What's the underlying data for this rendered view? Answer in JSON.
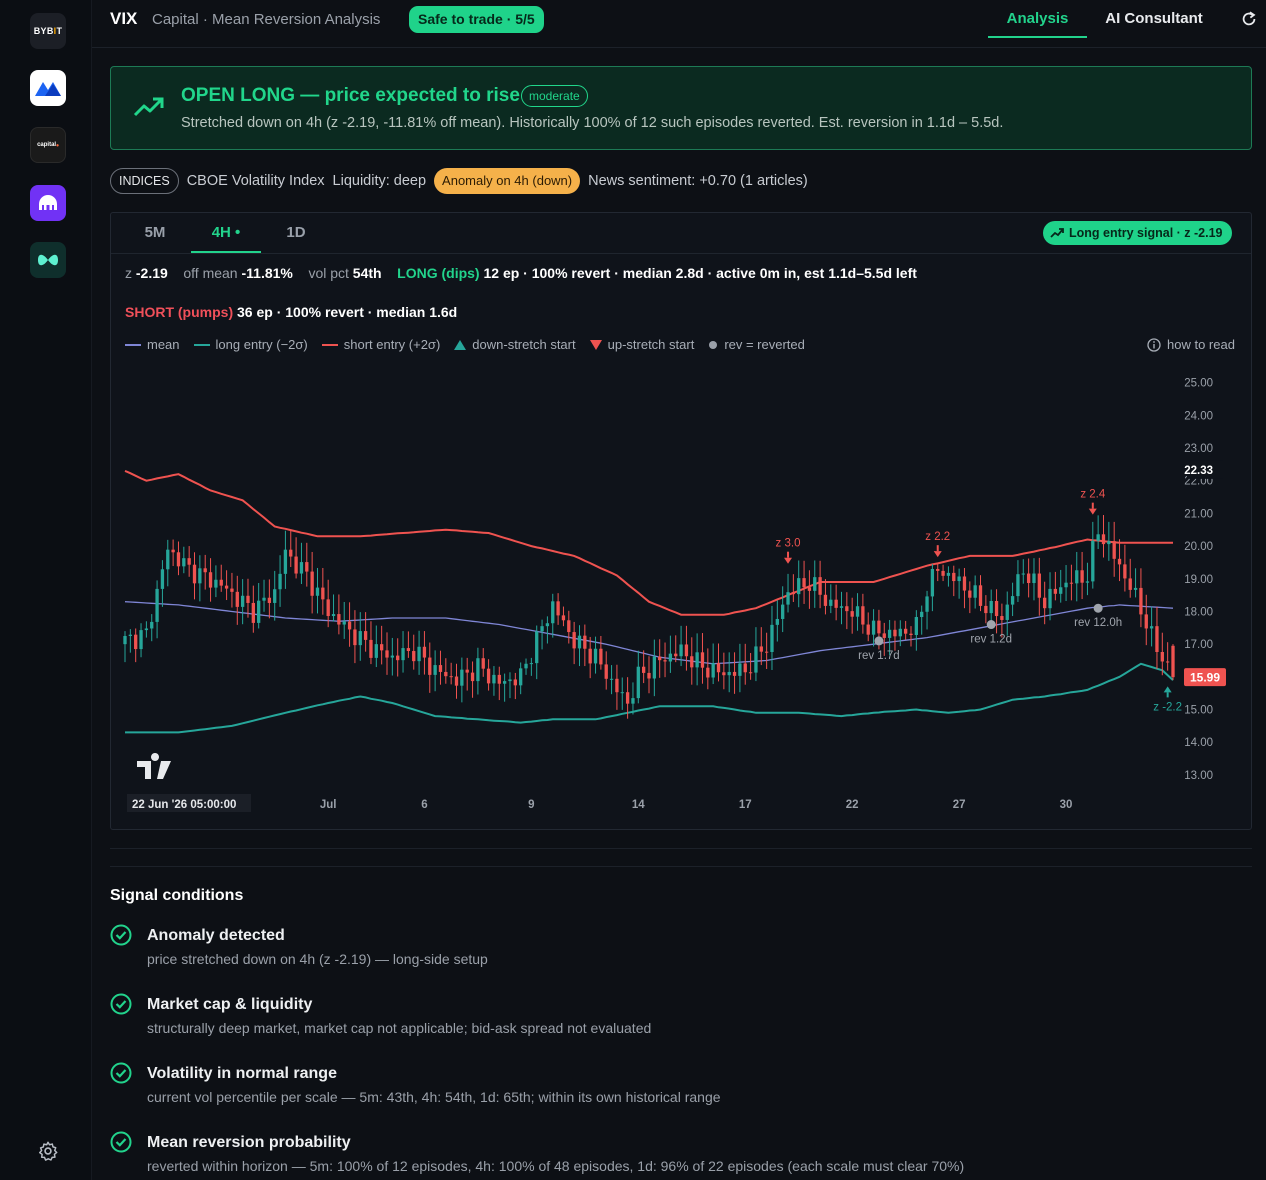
{
  "rail": {
    "bybit_label": "BYB",
    "bybit_bar": "I",
    "bybit_end": "T",
    "capital_label": "capital",
    "items": [
      "bybit",
      "mexc",
      "capital",
      "kraken",
      "other"
    ]
  },
  "header": {
    "ticker": "VIX",
    "subtitle": "Capital · Mean Reversion Analysis",
    "safe_badge": "Safe to trade · 5/5",
    "tab_analysis": "Analysis",
    "tab_ai": "AI Consultant"
  },
  "banner": {
    "title": "OPEN LONG — price expected to rise",
    "badge": "moderate",
    "text": "Stretched down on 4h (z -2.19, -11.81% off mean). Historically 100% of 12 such episodes reverted. Est. reversion in 1.1d – 5.5d."
  },
  "info": {
    "indices": "INDICES",
    "name": "CBOE Volatility Index",
    "liquidity": "Liquidity: deep",
    "anomaly": "Anomaly on 4h (down)",
    "news": "News sentiment: +0.70 (1 articles)"
  },
  "panel": {
    "tabs": [
      "5M",
      "4H",
      "1D"
    ],
    "active_dot": "•",
    "long_signal": "Long entry signal · z -2.19",
    "stats": {
      "z_label": "z",
      "z_val": "-2.19",
      "off_label": "off mean",
      "off_val": "-11.81%",
      "vol_label": "vol pct",
      "vol_val": "54th",
      "long_label": "LONG (dips)",
      "long_text": "12 ep · 100% revert · median 2.8d · active 0m in, est 1.1d–5.5d left",
      "short_label": "SHORT (pumps)",
      "short_text": "36 ep · 100% revert · median 1.6d"
    },
    "legend": {
      "mean": "mean",
      "long": "long entry (−2σ)",
      "short": "short entry (+2σ)",
      "down": "down-stretch start",
      "up": "up-stretch start",
      "rev": "rev = reverted",
      "howto": "how to read"
    },
    "colors": {
      "mean": "#7f86d6",
      "long": "#26a69a",
      "short": "#ef5350",
      "up_candle": "#26a69a",
      "down_candle": "#ef5350"
    }
  },
  "chart_data": {
    "type": "candlestick",
    "y_ticks": [
      "25.00",
      "24.00",
      "23.00",
      "22.00",
      "21.00",
      "20.00",
      "19.00",
      "18.00",
      "17.00",
      "16.00",
      "15.00",
      "14.00",
      "13.00"
    ],
    "ylim": [
      12.6,
      25.6
    ],
    "x_ticks": [
      {
        "label": "22 Jun '26  05:00:00",
        "i": 0
      },
      {
        "label": "Jul",
        "i": 38
      },
      {
        "label": "6",
        "i": 56
      },
      {
        "label": "9",
        "i": 76
      },
      {
        "label": "14",
        "i": 96
      },
      {
        "label": "17",
        "i": 116
      },
      {
        "label": "22",
        "i": 136
      },
      {
        "label": "27",
        "i": 156
      },
      {
        "label": "30",
        "i": 176
      }
    ],
    "last_price": "15.99",
    "crosshair_price": "22.33",
    "annotations": {
      "up_markers": [
        {
          "i": 124,
          "label": "z 3.0",
          "price": 19.4
        },
        {
          "i": 152,
          "label": "z 2.2",
          "price": 19.6
        },
        {
          "i": 181,
          "label": "z 2.4",
          "price": 20.9
        }
      ],
      "down_markers": [
        {
          "i": 195,
          "label": "z -2.2",
          "price": 15.8
        }
      ],
      "reverted": [
        {
          "i": 141,
          "label": "rev 1.7d",
          "price": 17.1
        },
        {
          "i": 162,
          "label": "rev 1.2d",
          "price": 17.6
        },
        {
          "i": 182,
          "label": "rev 12.0h",
          "price": 18.1
        }
      ]
    },
    "candles": [],
    "mean": [],
    "upper": [],
    "lower": []
  },
  "conditions": {
    "title": "Signal conditions",
    "items": [
      {
        "title": "Anomaly detected",
        "desc": "price stretched down on 4h (z -2.19) — long-side setup"
      },
      {
        "title": "Market cap & liquidity",
        "desc": "structurally deep market, market cap not applicable; bid-ask spread not evaluated"
      },
      {
        "title": "Volatility in normal range",
        "desc": "current vol percentile per scale — 5m: 43th, 4h: 54th, 1d: 65th; within its own historical range"
      },
      {
        "title": "Mean reversion probability",
        "desc": "reverted within horizon — 5m: 100% of 12 episodes, 4h: 100% of 48 episodes, 1d: 96% of 22 episodes (each scale must clear 70%)"
      }
    ]
  }
}
